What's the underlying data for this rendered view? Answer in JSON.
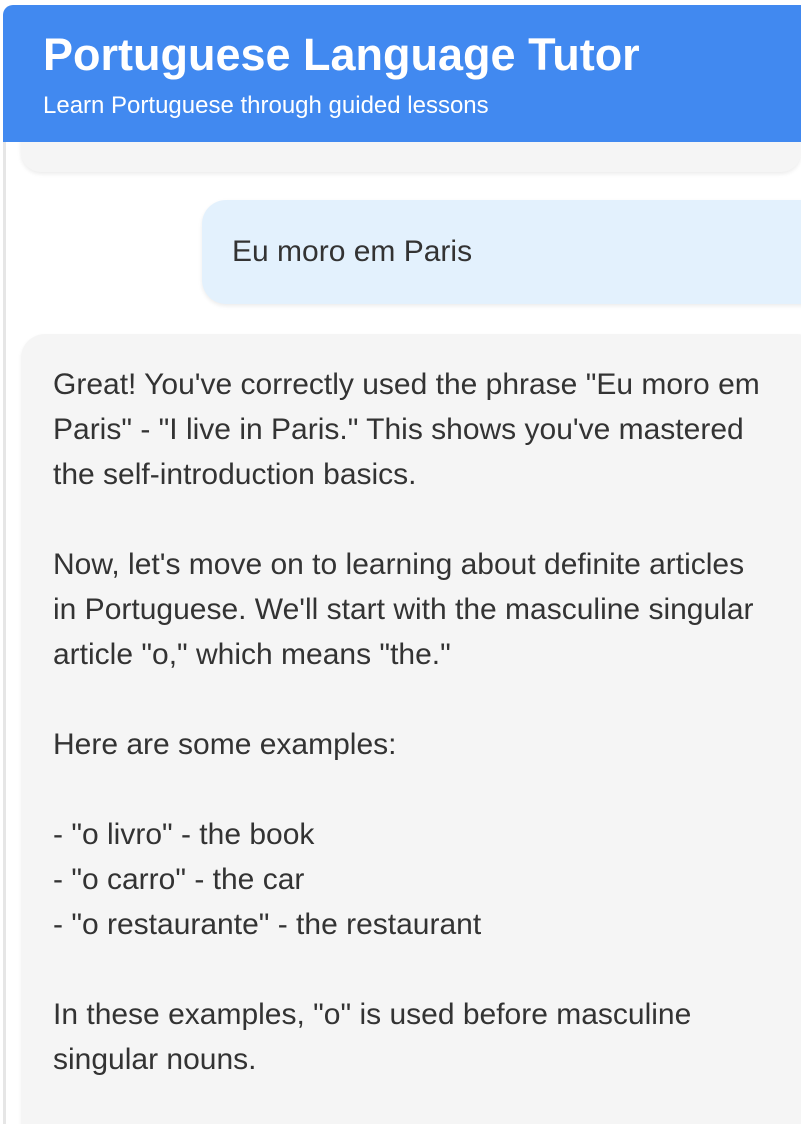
{
  "header": {
    "title": "Portuguese Language Tutor",
    "subtitle": "Learn Portuguese through guided lessons"
  },
  "messages": {
    "user": {
      "text": "Eu moro em Paris"
    },
    "tutor": {
      "paragraph_1": "Great! You've correctly used the phrase \"Eu moro em Paris\" - \"I live in Paris.\" This shows you've mastered the self-introduction basics.",
      "paragraph_2": "Now, let's move on to learning about definite articles in Portuguese. We'll start with the masculine singular article \"o,\" which means \"the.\"",
      "paragraph_3": "Here are some examples:",
      "examples": [
        "- \"o livro\" - the book",
        "- \"o carro\" - the car",
        "- \"o restaurante\" - the restaurant"
      ],
      "paragraph_4": "In these examples, \"o\" is used before masculine singular nouns."
    }
  },
  "colors": {
    "header_background": "#4189f0",
    "user_bubble": "#e3f1fd",
    "tutor_bubble": "#f5f5f5",
    "text": "#333333"
  }
}
